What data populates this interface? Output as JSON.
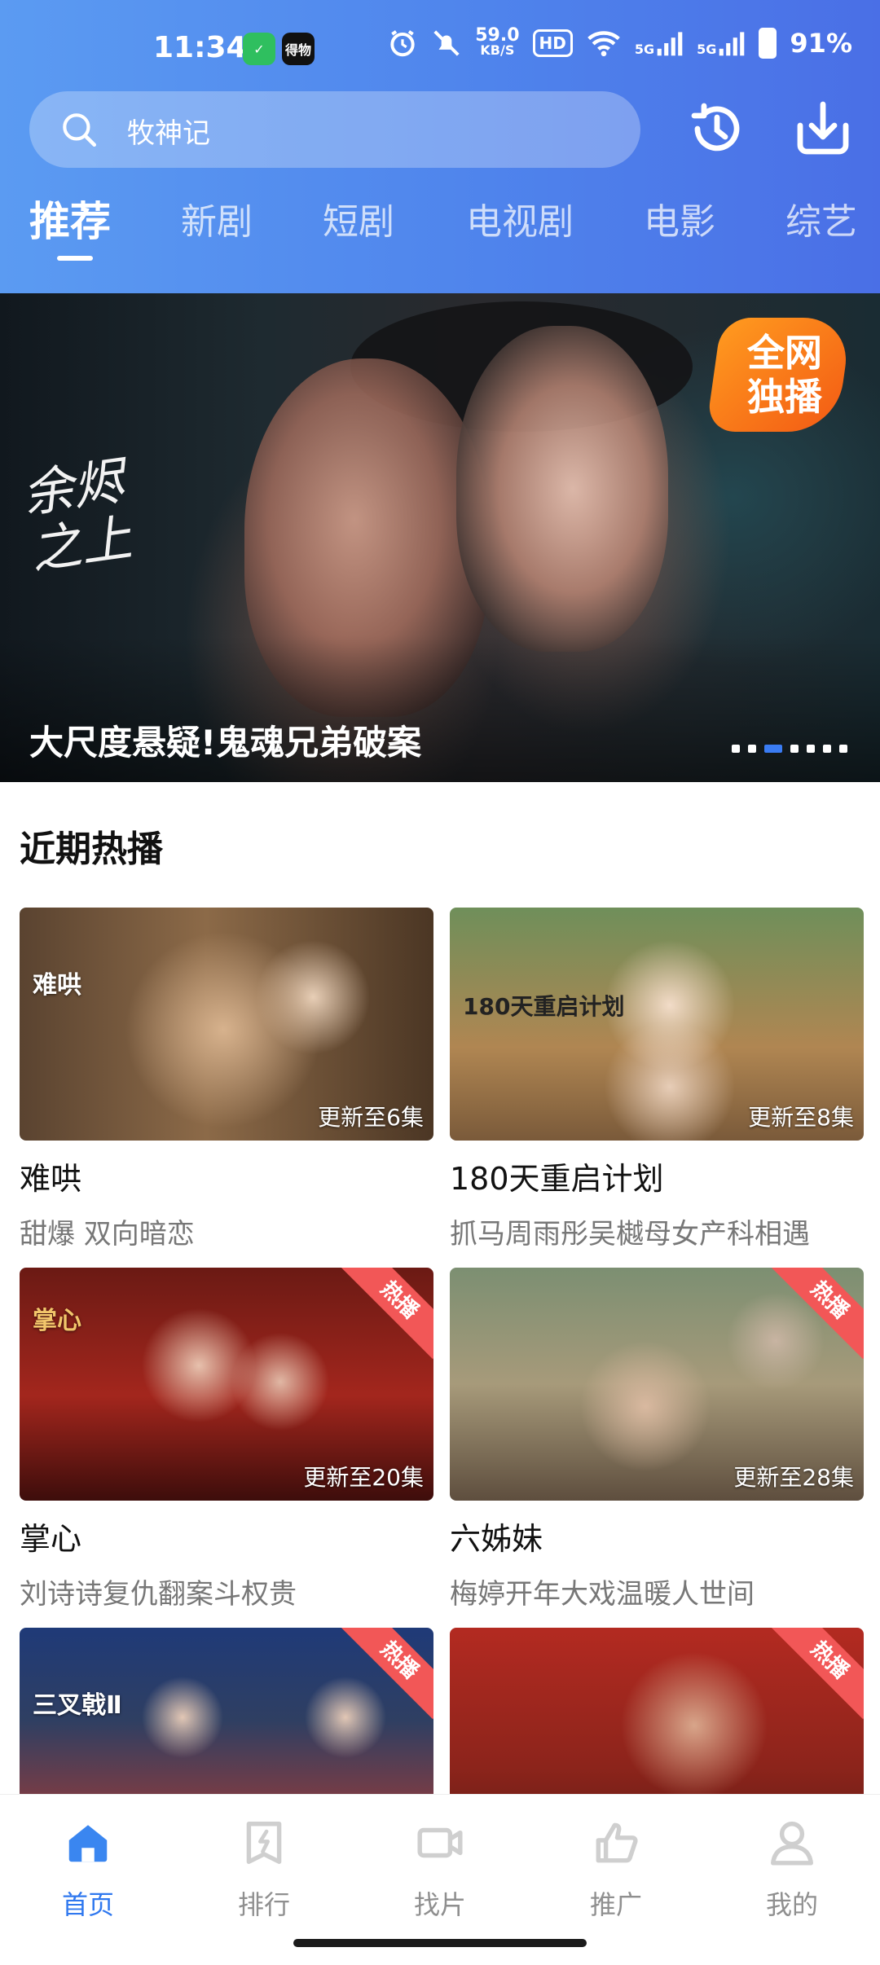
{
  "status": {
    "time": "11:34",
    "app_badge_1": "✓",
    "app_badge_2": "得物",
    "net_speed": "59.0",
    "net_unit": "KB/S",
    "hd": "HD",
    "sig1": "5G",
    "sig2": "5G",
    "battery": "91%"
  },
  "search": {
    "placeholder": "牧神记"
  },
  "tabs": [
    "推荐",
    "新剧",
    "短剧",
    "电视剧",
    "电影",
    "综艺"
  ],
  "banner": {
    "logo_text": "余烬之上",
    "badge_line1": "全网",
    "badge_line2": "独播",
    "caption": "大尺度悬疑!鬼魂兄弟破案",
    "active_dot": 2,
    "dot_count": 7
  },
  "section": {
    "title": "近期热播"
  },
  "cards": [
    {
      "title": "难哄",
      "subtitle": "甜爆 双向暗恋",
      "episodes": "更新至6集",
      "hot": "",
      "thumb_label": "难哄"
    },
    {
      "title": "180天重启计划",
      "subtitle": "抓马周雨彤吴樾母女产科相遇",
      "episodes": "更新至8集",
      "hot": "",
      "thumb_label": "180天重启计划"
    },
    {
      "title": "掌心",
      "subtitle": "刘诗诗复仇翻案斗权贵",
      "episodes": "更新至20集",
      "hot": "热播",
      "thumb_label": "掌心"
    },
    {
      "title": "六姊妹",
      "subtitle": "梅婷开年大戏温暖人世间",
      "episodes": "更新至28集",
      "hot": "热播",
      "thumb_label": ""
    },
    {
      "title": "",
      "subtitle": "",
      "episodes": "",
      "hot": "热播",
      "thumb_label": "三叉戟Ⅱ"
    },
    {
      "title": "",
      "subtitle": "",
      "episodes": "",
      "hot": "热播",
      "thumb_label": ""
    }
  ],
  "nav": [
    {
      "label": "首页",
      "icon": "home-icon",
      "active": true
    },
    {
      "label": "排行",
      "icon": "ranking-icon",
      "active": false
    },
    {
      "label": "找片",
      "icon": "video-camera-icon",
      "active": false
    },
    {
      "label": "推广",
      "icon": "thumbs-up-icon",
      "active": false
    },
    {
      "label": "我的",
      "icon": "user-icon",
      "active": false
    }
  ],
  "colors": {
    "accent": "#2f78ef",
    "header_from": "#5b9bf2",
    "header_to": "#4a6fe6",
    "hot_badge": "#f25757"
  }
}
